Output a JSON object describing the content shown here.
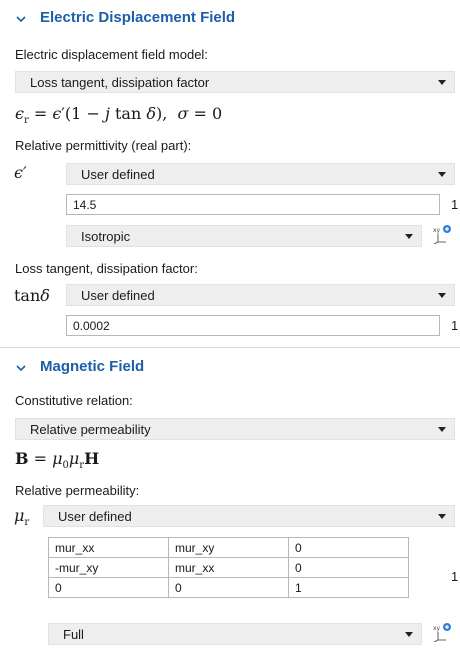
{
  "electric": {
    "title": "Electric Displacement Field",
    "model_label": "Electric displacement field model:",
    "model_value": "Loss tangent, dissipation factor",
    "permittivity_label": "Relative permittivity (real part):",
    "eps_source": "User defined",
    "eps_value": "14.5",
    "eps_unit": "1",
    "eps_type": "Isotropic",
    "loss_label": "Loss tangent, dissipation factor:",
    "tan_source": "User defined",
    "tan_value": "0.0002",
    "tan_unit": "1"
  },
  "magnetic": {
    "title": "Magnetic Field",
    "relation_label": "Constitutive relation:",
    "relation_value": "Relative permeability",
    "perm_label": "Relative permeability:",
    "mu_source": "User defined",
    "matrix": [
      [
        "mur_xx",
        "mur_xy",
        "0"
      ],
      [
        "-mur_xy",
        "mur_xx",
        "0"
      ],
      [
        "0",
        "0",
        "1"
      ]
    ],
    "mu_unit": "1",
    "mu_type": "Full"
  },
  "icons": [
    "chevron-down-icon",
    "dropdown-arrow-icon",
    "coordinate-system-icon"
  ]
}
